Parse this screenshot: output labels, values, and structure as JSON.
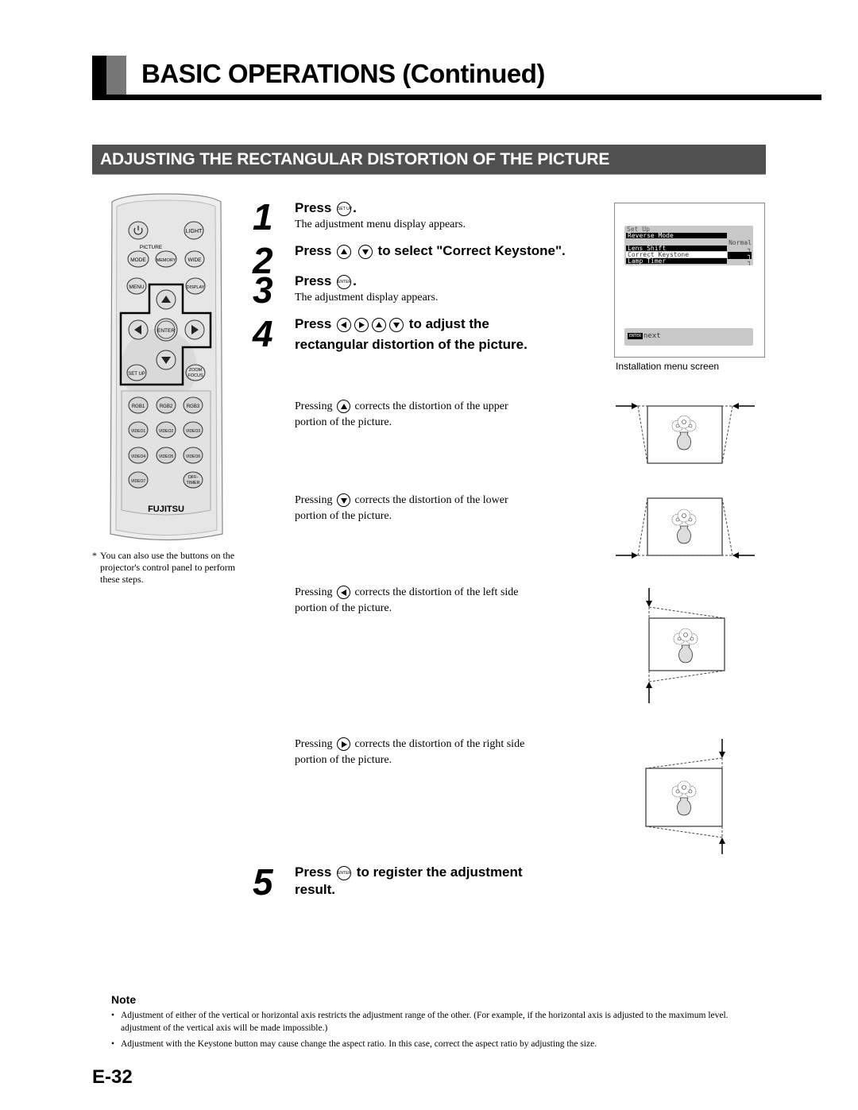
{
  "header": {
    "title": "BASIC OPERATIONS (Continued)"
  },
  "section": {
    "title": "ADJUSTING THE RECTANGULAR DISTORTION OF THE PICTURE"
  },
  "remote": {
    "brand": "FUJITSU",
    "picture_label": "PICTURE",
    "buttons": {
      "power": "power",
      "light": "LIGHT",
      "mode": "MODE",
      "memory": "MEMORY",
      "wide": "WIDE",
      "menu": "MENU",
      "display": "DISPLAY",
      "enter": "ENTER",
      "setup": "SET UP",
      "zoom_focus_1": "ZOOM",
      "zoom_focus_2": "FOCUS",
      "rgb1": "RGB1",
      "rgb2": "RGB2",
      "rgb3": "RGB3",
      "video1": "VIDEO1",
      "video2": "VIDEO2",
      "video3": "VIDEO3",
      "video4": "VIDEO4",
      "video5": "VIDEO5",
      "video6": "VIDEO6",
      "video7": "VIDEO7",
      "offtimer_1": "OFF-",
      "offtimer_2": "TIMER"
    },
    "footnote_star": "*",
    "footnote": "You can also use the buttons on the projector's control panel to perform these steps."
  },
  "steps": [
    {
      "num": "1",
      "press": "Press",
      "after": ".",
      "icon": "SET UP",
      "sub": "The adjustment menu display appears."
    },
    {
      "num": "2",
      "press": "Press",
      "after": "to select \"Correct Keystone\"."
    },
    {
      "num": "3",
      "press": "Press",
      "after": ".",
      "icon": "ENTER",
      "sub": "The adjustment display appears."
    },
    {
      "num": "4",
      "press": "Press",
      "after": "to adjust the",
      "line2": "rectangular distortion of the picture."
    },
    {
      "num": "5",
      "press": "Press",
      "icon": "ENTER",
      "after": "to register the adjustment",
      "line2": "result."
    }
  ],
  "descriptions": [
    {
      "pre": "Pressing",
      "post": "corrects the distortion of the upper",
      "line2": "portion of the picture.",
      "icon": "up-arrow"
    },
    {
      "pre": "Pressing",
      "post": "corrects the distortion of the lower",
      "line2": "portion of the picture.",
      "icon": "down-arrow"
    },
    {
      "pre": "Pressing",
      "post": "corrects the distortion of the left side",
      "line2": "portion of the picture.",
      "icon": "left-arrow"
    },
    {
      "pre": "Pressing",
      "post": "corrects the distortion of the right side",
      "line2": "portion of the picture.",
      "icon": "right-arrow"
    }
  ],
  "menu_screen": {
    "title": "Set Up",
    "items": [
      "Reverse Mode",
      "Lens Shift",
      "Correct Keystone",
      "Lamp Timer"
    ],
    "selected": "Correct Keystone",
    "value_reverse_mode": "Normal",
    "value_mark": "┐",
    "footer_key": "ENTER",
    "footer_text": "next",
    "caption": "Installation menu screen"
  },
  "note": {
    "title": "Note",
    "items": [
      "Adjustment of either of the vertical or horizontal axis restricts the adjustment range of the other. (For example, if the horizontal axis is adjusted to the maximum level. adjustment of the vertical axis will be made impossible.)",
      "Adjustment with the Keystone button may cause change the aspect ratio. In this case, correct the aspect ratio by adjusting the size."
    ]
  },
  "page_number": "E-32"
}
